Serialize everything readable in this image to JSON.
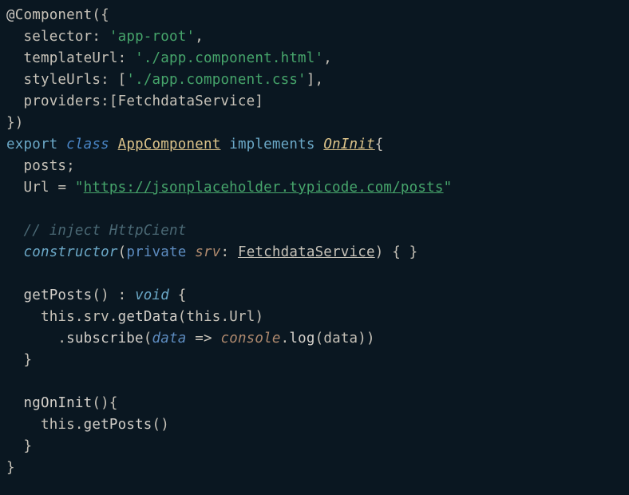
{
  "code": {
    "decorator_at": "@",
    "decorator_name": "Component",
    "decorator_open": "({",
    "selector_key": "selector",
    "selector_val": "'app-root'",
    "templateUrl_key": "templateUrl",
    "templateUrl_val": "'./app.component.html'",
    "styleUrls_key": "styleUrls",
    "styleUrls_open": "[",
    "styleUrls_val": "'./app.component.css'",
    "styleUrls_close": "],",
    "providers_key": "providers",
    "providers_open": ":[",
    "providers_val": "FetchdataService",
    "providers_close": "]",
    "decorator_close": "})",
    "export_kw": "export",
    "class_kw": "class",
    "class_name": "AppComponent",
    "implements_kw": "implements",
    "interface_name": "OnInit",
    "posts_prop": "posts",
    "url_prop": "Url",
    "url_val_open": "\"",
    "url_val": "https://jsonplaceholder.typicode.com/posts",
    "url_val_close": "\"",
    "comment1": "// inject HttpCient",
    "constructor_kw": "constructor",
    "private_kw": "private",
    "srv_param": "srv",
    "srv_type": "FetchdataService",
    "getPosts_name": "getPosts",
    "void_type": "void",
    "this_kw": "this",
    "srv_ref": "srv",
    "getData_call": "getData",
    "url_ref": "Url",
    "subscribe_call": "subscribe",
    "data_param": "data",
    "arrow": "=>",
    "console_ident": "console",
    "log_call": "log",
    "ngOnInit_name": "ngOnInit",
    "getPosts_call": "getPosts"
  }
}
